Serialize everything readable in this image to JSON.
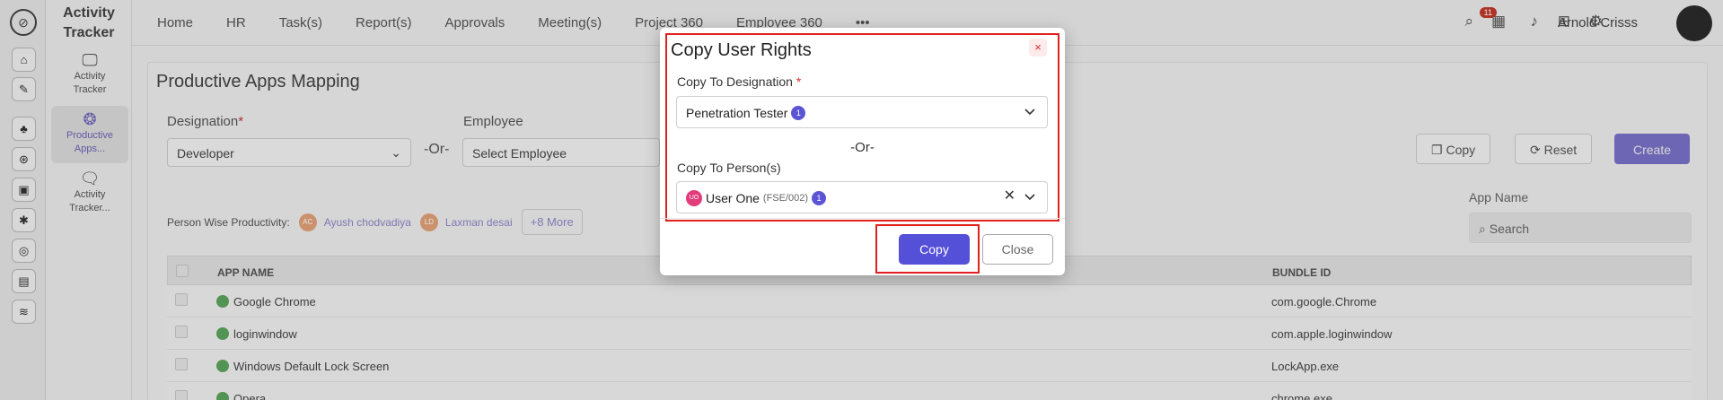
{
  "app": {
    "brand_line1": "Activity",
    "brand_line2": "Tracker"
  },
  "top_nav": {
    "items": [
      "Home",
      "HR",
      "Task(s)",
      "Report(s)",
      "Approvals",
      "Meeting(s)",
      "Project 360",
      "Employee 360"
    ],
    "more_icon": "more-horizontal-icon",
    "notification_count": "11",
    "user_name": "Arnold Crisss"
  },
  "sub_nav": {
    "items": [
      {
        "label_1": "Activity",
        "label_2": "Tracker",
        "icon": "monitor-icon"
      },
      {
        "label_1": "Productive",
        "label_2": "Apps...",
        "icon": "aperture-icon"
      },
      {
        "label_1": "Activity",
        "label_2": "Tracker...",
        "icon": "monitor-chat-icon"
      }
    ]
  },
  "page": {
    "title": "Productive Apps Mapping",
    "designation_label": "Designation",
    "designation_value": "Developer",
    "or_text": "-Or-",
    "employee_label": "Employee",
    "employee_placeholder": "Select Employee",
    "buttons": {
      "copy": "Copy",
      "reset": "Reset",
      "create": "Create"
    },
    "person_wise_label": "Person Wise Productivity:",
    "persons": [
      {
        "initials": "AC",
        "name": "Ayush chodvadiya"
      },
      {
        "initials": "LD",
        "name": "Laxman desai"
      }
    ],
    "more_persons": "+8 More",
    "app_name_label": "App Name",
    "search_placeholder": "Search",
    "table": {
      "headers": [
        "APP NAME",
        "BUNDLE ID"
      ],
      "rows": [
        {
          "app": "Google Chrome",
          "bundle": "com.google.Chrome"
        },
        {
          "app": "loginwindow",
          "bundle": "com.apple.loginwindow"
        },
        {
          "app": "Windows Default Lock Screen",
          "bundle": "LockApp.exe"
        },
        {
          "app": "Opera",
          "bundle": "chrome.exe"
        }
      ]
    }
  },
  "modal": {
    "title": "Copy User Rights",
    "close_icon": "×",
    "designation_label": "Copy To Designation",
    "designation_value": "Penetration Tester",
    "designation_count": "1",
    "or_text": "-Or-",
    "person_label": "Copy To Person(s)",
    "person_initials": "UO",
    "person_name": "User One",
    "person_id": "(FSE/002)",
    "person_count": "1",
    "clear_icon": "✕",
    "copy_button": "Copy",
    "close_button": "Close"
  },
  "colors": {
    "highlight": "#e0201e",
    "primary": "#5550d8",
    "danger": "#d62e2e"
  }
}
